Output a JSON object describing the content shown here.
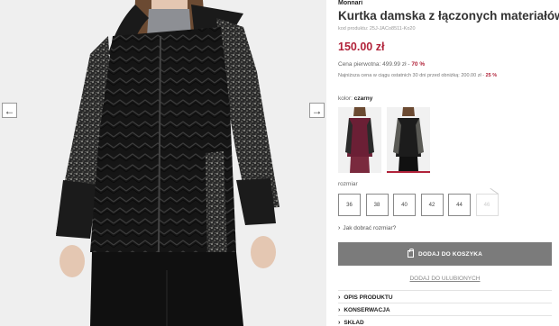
{
  "gallery": {
    "prev_label": "←",
    "next_label": "→"
  },
  "product": {
    "brand": "Monnari",
    "title": "Kurtka damska z łączonych materiałów",
    "code": "kod produktu: 25J-JACo8511-Ko20",
    "price": "150.00 zł",
    "original_price_text": "Cena pierwotna: 499.99 zł -",
    "original_discount": "70 %",
    "lowest_price_text": "Najniższa cena w ciągu ostatnich 30 dni przed obniżką: 200.00 zł -",
    "lowest_discount": "25 %"
  },
  "color": {
    "label": "kolor:",
    "value": "czarny"
  },
  "sizes": {
    "label": "rozmiar",
    "options": [
      "36",
      "38",
      "40",
      "42",
      "44",
      "46"
    ],
    "unavailable": [
      "46"
    ]
  },
  "size_guide": "Jak dobrać rozmiar?",
  "actions": {
    "add_to_cart": "DODAJ DO KOSZYKA",
    "add_to_favorites": "DODAJ DO ULUBIONYCH"
  },
  "accordion": [
    "OPIS PRODUKTU",
    "KONSERWACJA",
    "SKŁAD"
  ],
  "colors": {
    "accent": "#b1233a",
    "button": "#7b7b7b"
  }
}
